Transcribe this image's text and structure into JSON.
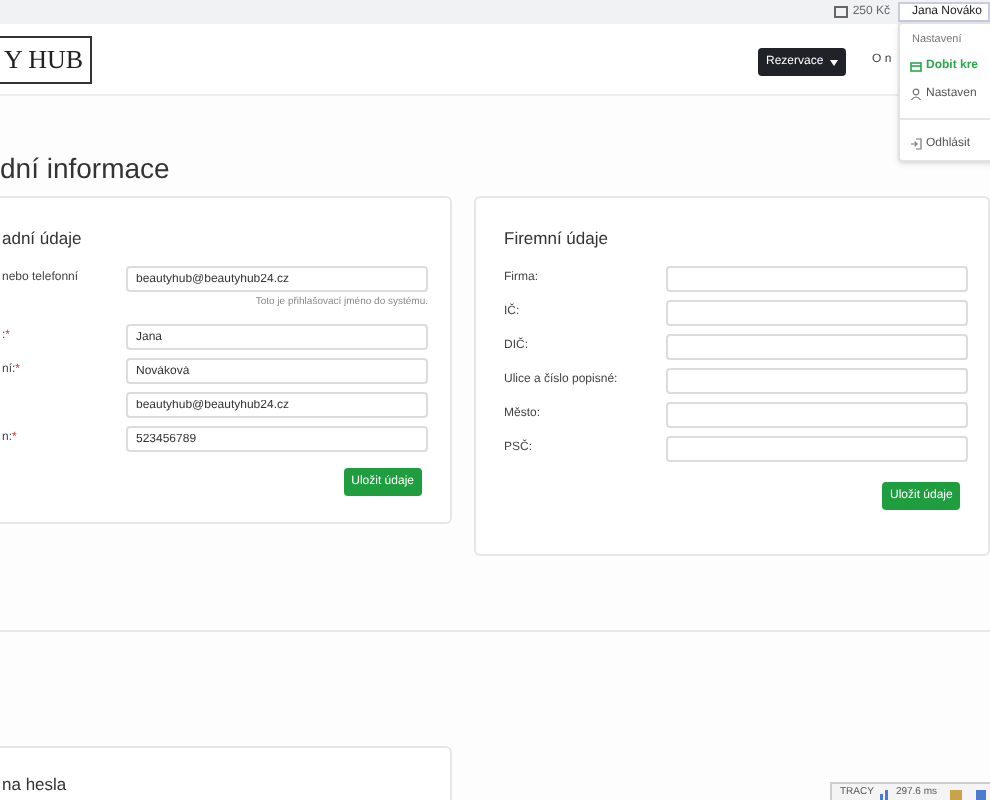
{
  "top_bar": {
    "credit": "250 Kč",
    "user_button": "Jana Nováko"
  },
  "header": {
    "logo": "Y HUB",
    "reservation_button": "Rezervace",
    "nav_link": "O n"
  },
  "user_menu": {
    "header": "Nastavení",
    "items": [
      {
        "label": "Dobit kre",
        "kind": "credit"
      },
      {
        "label": "Nastaven",
        "kind": "settings"
      },
      {
        "label": "Odhlásit",
        "kind": "logout"
      }
    ]
  },
  "page_title": "dní informace",
  "personal_card": {
    "title": "adní údaje",
    "fields": [
      {
        "label": "nebo telefonní",
        "value": "beautyhub@beautyhub24.cz",
        "hint": "Toto je přihlašovací jméno do systému."
      },
      {
        "label": ":",
        "required_mark": "*",
        "value": "Jana"
      },
      {
        "label": "ní:",
        "required_mark": "*",
        "value": "Nováková"
      },
      {
        "value": "beautyhub@beautyhub24.cz"
      },
      {
        "label": "n:",
        "required_mark": "*",
        "value": "523456789"
      }
    ],
    "button": "Uložit údaje"
  },
  "company_card": {
    "title": "Firemní údaje",
    "fields": [
      {
        "label": "Firma:"
      },
      {
        "label": "IČ:"
      },
      {
        "label": "DIČ:"
      },
      {
        "label": "Ulice a číslo popisné:"
      },
      {
        "label": "Město:"
      },
      {
        "label": "PSČ:"
      }
    ],
    "button": "Uložit údaje"
  },
  "password_card": {
    "title": "na hesla"
  },
  "debug_bar": {
    "label": "TRACY",
    "time": "297.6 ms"
  }
}
